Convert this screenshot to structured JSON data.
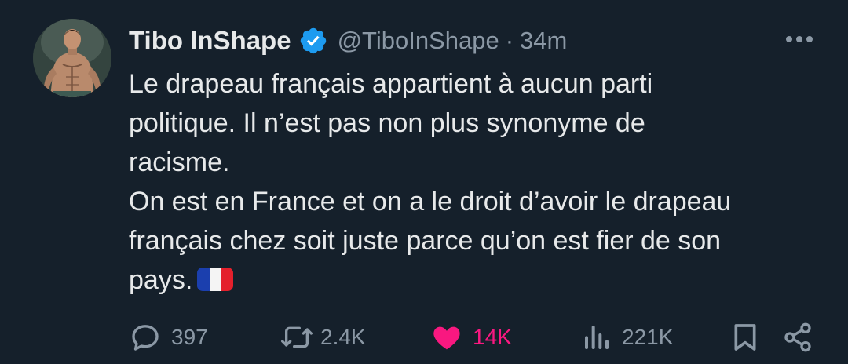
{
  "author": {
    "name": "Tibo InShape",
    "handle": "@TiboInShape",
    "separator": "·",
    "time": "34m"
  },
  "tweet": {
    "lines": [
      "Le drapeau français appartient à aucun parti",
      "politique. Il n’est pas non plus synonyme de",
      "racisme.",
      "On est en France et on a le droit d’avoir le drapeau",
      "français chez soit juste parce qu’on est fier de son",
      "pays."
    ],
    "emoji": "france-flag"
  },
  "actions": {
    "replies": "397",
    "reposts": "2.4K",
    "likes": "14K",
    "views": "221K"
  },
  "icons": {
    "verified": "verified-badge-icon",
    "more": "more-icon",
    "reply": "reply-icon",
    "repost": "repost-icon",
    "like": "heart-icon",
    "views": "views-icon",
    "bookmark": "bookmark-icon",
    "share": "share-icon"
  },
  "colors": {
    "background": "#15202b",
    "text": "#e7e9ea",
    "muted": "#8b98a5",
    "verified": "#1d9bf0",
    "like": "#f91880"
  }
}
